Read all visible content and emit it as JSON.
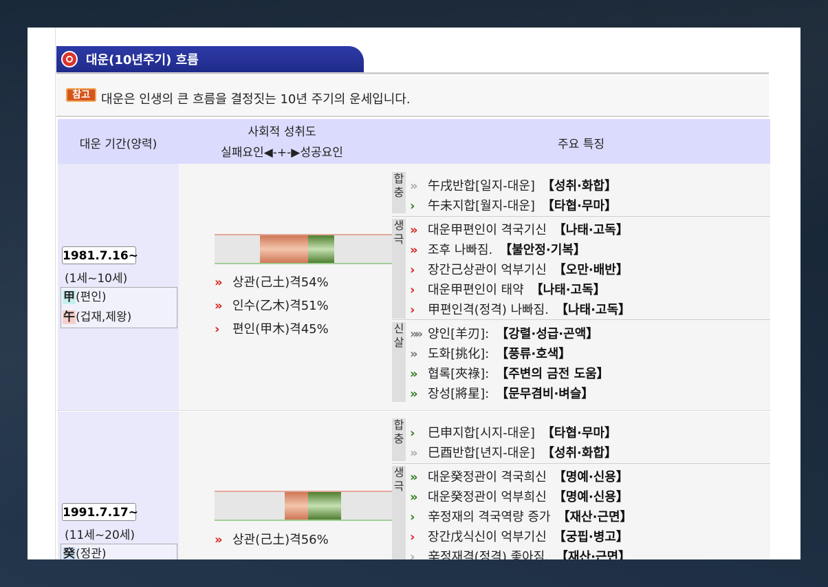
{
  "section": {
    "title": "대운(10년주기) 흐름",
    "note_badge": "참고",
    "note_text": "대운은 인생의 큰 흐름을 결정짓는 10년 주기의 운세입니다."
  },
  "header": {
    "col_period": "대운 기간(양력)",
    "col_achieve_line1": "사회적 성취도",
    "col_achieve_line2": "실패요인◀-+-▶성공요인",
    "col_features": "주요 특징"
  },
  "periods": [
    {
      "date": "1981.7.16~",
      "age": "(1세~10세)",
      "gan": {
        "char": "甲",
        "rel": "(편인)"
      },
      "ji": {
        "char": "午",
        "rel": "(겁재,제왕)"
      },
      "gyeok": [
        {
          "arrow": "»",
          "text": "상관(己土)격54%"
        },
        {
          "arrow": "»",
          "text": "인수(乙木)격51%"
        },
        {
          "arrow": "›",
          "text": "편인(甲木)격45%"
        }
      ],
      "cats": {
        "hapchung": "합충",
        "saenggeuk": "생극",
        "sinsal": "신살"
      },
      "hapchung": [
        {
          "arrow": "»",
          "text": "午戌반합[일지-대운]",
          "tag": "【성취·화합】"
        },
        {
          "arrow": "›",
          "text": "午未지합[월지-대운]",
          "tag": "【타협·무마】"
        }
      ],
      "saenggeuk": [
        {
          "arrow": "»",
          "text": "대운甲편인이 격국기신",
          "tag": "【나태·고독】"
        },
        {
          "arrow": "»",
          "text": "조후 나빠짐.",
          "tag": "【불안정·기복】"
        },
        {
          "arrow": "›",
          "text": "장간己상관이 억부기신",
          "tag": "【오만·배반】"
        },
        {
          "arrow": "›",
          "text": "대운甲편인이 태약",
          "tag": "【나태·고독】"
        },
        {
          "arrow": "›",
          "text": "甲편인격(정격) 나빠짐.",
          "tag": "【나태·고독】"
        }
      ],
      "sinsal": [
        {
          "arrow": "»»",
          "text": "양인[羊刃]:",
          "tag": "【강렬·성급·곤액】"
        },
        {
          "arrow": "»",
          "text": "도화[挑化]:",
          "tag": "【풍류·호색】"
        },
        {
          "arrow": "»",
          "text": "협록[夾祿]:",
          "tag": "【주변의 금전 도움】"
        },
        {
          "arrow": "»",
          "text": "장성[將星]:",
          "tag": "【문무겸비·벼슬】"
        }
      ]
    },
    {
      "date": "1991.7.17~",
      "age": "(11세~20세)",
      "gan": {
        "char": "癸",
        "rel": "(정관)"
      },
      "gyeok": [
        {
          "arrow": "»",
          "text": "상관(己土)격56%"
        }
      ],
      "cats": {
        "hapchung": "합충",
        "saenggeuk": "생극"
      },
      "hapchung": [
        {
          "arrow": "›",
          "text": "巳申지합[시지-대운]",
          "tag": "【타협·무마】"
        },
        {
          "arrow": "»",
          "text": "巳酉반합[년지-대운]",
          "tag": "【성취·화합】"
        }
      ],
      "saenggeuk": [
        {
          "arrow": "»",
          "text": "대운癸정관이 격국희신",
          "tag": "【명예·신용】"
        },
        {
          "arrow": "»",
          "text": "대운癸정관이 억부희신",
          "tag": "【명예·신용】"
        },
        {
          "arrow": "›",
          "text": "辛정재의 격국역량 증가",
          "tag": "【재산·근면】"
        },
        {
          "arrow": "›",
          "text": "장간戊식신이 억부기신",
          "tag": "【궁핍·병고】"
        },
        {
          "arrow": "›",
          "text": "辛정재격(정격) 좋아짐.",
          "tag": "【재산·근면】"
        }
      ]
    }
  ],
  "colors": {
    "title_bar": "#2e3aa6",
    "header_bg": "#dbdbfd",
    "arrow_red": "#d8231b",
    "arrow_green": "#2e7d1c",
    "note_badge": "#d4561c"
  }
}
